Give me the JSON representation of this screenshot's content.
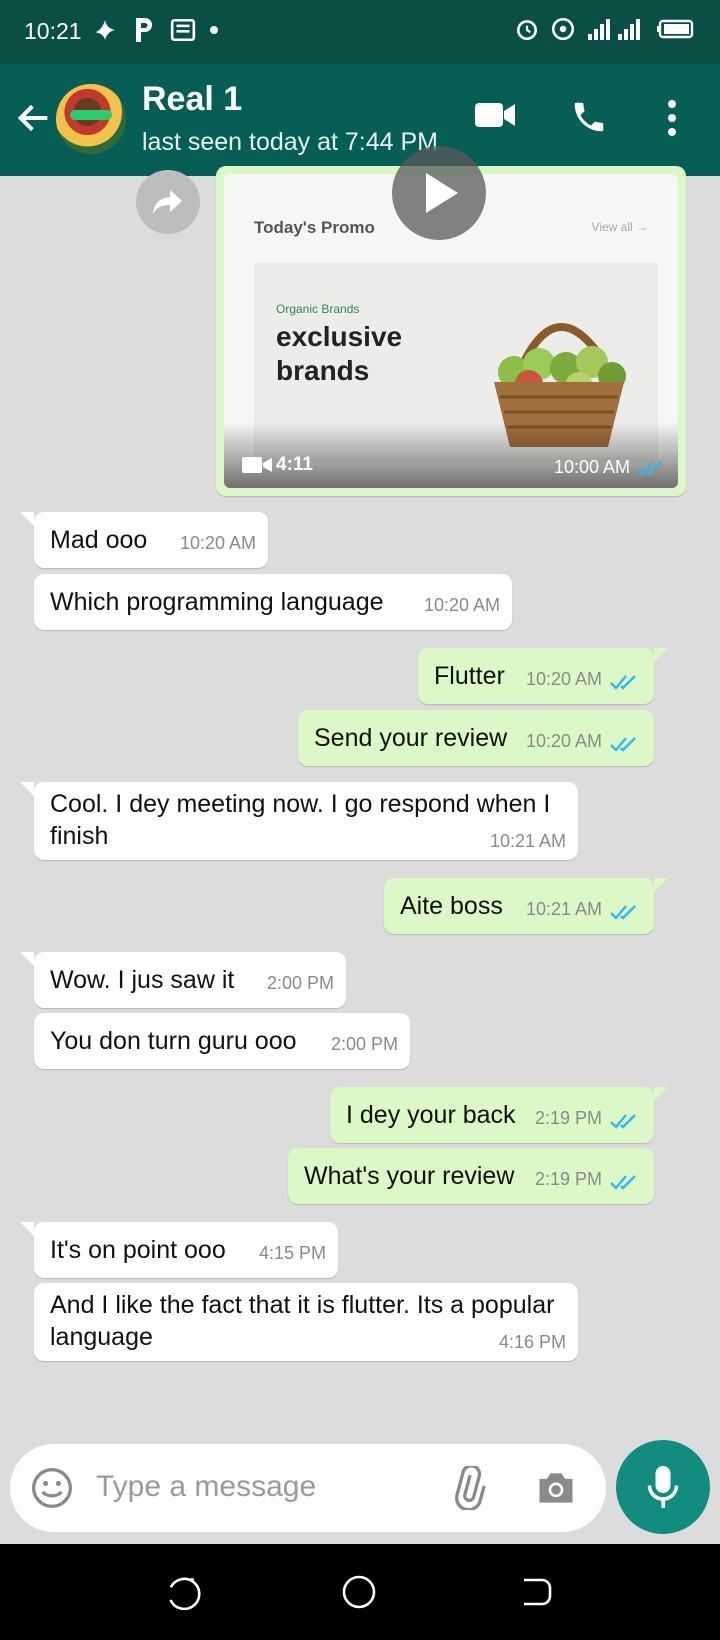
{
  "status_bar": {
    "time": "10:21"
  },
  "header": {
    "contact_name": "Real 1",
    "last_seen": "last seen today at 7:44 PM"
  },
  "video_message": {
    "thumbnail": {
      "section_title": "Today's Promo",
      "view_all": "View all →",
      "category": "Organic Brands",
      "headline": "exclusive brands"
    },
    "duration": "4:11",
    "time": "10:00 AM",
    "status_icon": "read-ticks"
  },
  "messages": [
    {
      "dir": "in",
      "text": "Mad ooo",
      "time": "10:20 AM"
    },
    {
      "dir": "in",
      "text": "Which programming language",
      "time": "10:20 AM"
    },
    {
      "dir": "out",
      "text": "Flutter",
      "time": "10:20 AM"
    },
    {
      "dir": "out",
      "text": "Send your review",
      "time": "10:20 AM"
    },
    {
      "dir": "in",
      "text": "Cool. I dey meeting now. I go respond when I finish",
      "time": "10:21 AM"
    },
    {
      "dir": "out",
      "text": "Aite boss",
      "time": "10:21 AM"
    },
    {
      "dir": "in",
      "text": "Wow. I jus saw it",
      "time": "2:00 PM"
    },
    {
      "dir": "in",
      "text": "You don turn guru ooo",
      "time": "2:00 PM"
    },
    {
      "dir": "out",
      "text": "I dey your back",
      "time": "2:19 PM"
    },
    {
      "dir": "out",
      "text": "What's your review",
      "time": "2:19 PM"
    },
    {
      "dir": "in",
      "text": "It's on point ooo",
      "time": "4:15 PM"
    },
    {
      "dir": "in",
      "text": "And I like the fact that it is flutter. Its a popular language",
      "time": "4:16 PM"
    }
  ],
  "composer": {
    "placeholder": "Type a message"
  },
  "colors": {
    "header": "#075e54",
    "status_bar": "#0a4f46",
    "outgoing_bubble": "#dcf8c6",
    "incoming_bubble": "#ffffff",
    "read_ticks": "#34b7f1",
    "mic_button": "#128c7e"
  }
}
